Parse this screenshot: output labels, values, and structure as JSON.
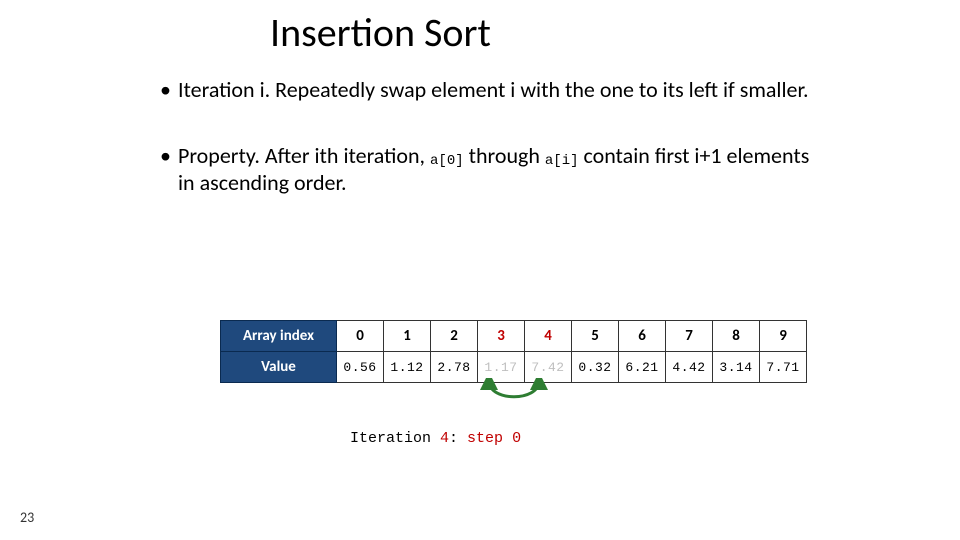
{
  "title": "Insertion Sort",
  "bullet1a": "Iteration i.  Repeatedly swap element i with the one to its left if smaller.",
  "bullet2_pre": "Property.  After ith iteration, ",
  "bullet2_code1": "a[0]",
  "bullet2_mid": " through ",
  "bullet2_code2": "a[i]",
  "bullet2_post": " contain first i+1 elements in ascending order.",
  "rowhead_index": "Array index",
  "rowhead_value": "Value",
  "indices": [
    "0",
    "1",
    "2",
    "3",
    "4",
    "5",
    "6",
    "7",
    "8",
    "9"
  ],
  "values": [
    "0.56",
    "1.12",
    "2.78",
    "1.17",
    "7.42",
    "0.32",
    "6.21",
    "4.42",
    "3.14",
    "7.71"
  ],
  "highlight_cols": [
    3,
    4
  ],
  "caption_pre": "Iteration ",
  "caption_iter": "4",
  "caption_mid": ": ",
  "caption_step_word": "step ",
  "caption_step_n": "0",
  "pagenum": "23"
}
